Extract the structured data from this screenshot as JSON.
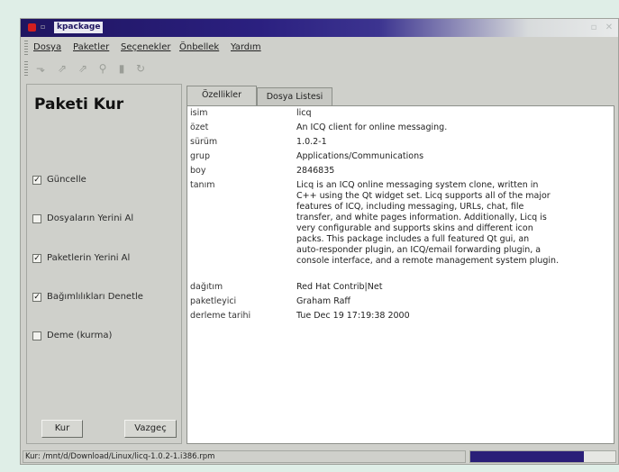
{
  "window": {
    "title": "kpackage",
    "close_icon": "close-icon",
    "menu_icon": "window-menu-icon",
    "minimize_icon": "minimize-icon",
    "maximize_icon": "maximize-icon"
  },
  "menu": {
    "items": [
      "Dosya",
      "Paketler",
      "Seçenekler",
      "Önbellek",
      "Yardım"
    ]
  },
  "toolbar": {
    "icons": [
      "open-icon",
      "install-icon",
      "uninstall-icon",
      "find-icon",
      "list-icon",
      "reload-icon"
    ]
  },
  "install_panel": {
    "title": "Paketi Kur",
    "options": [
      {
        "label": "Güncelle",
        "checked": true
      },
      {
        "label": "Dosyaların Yerini Al",
        "checked": false
      },
      {
        "label": "Paketlerin Yerini Al",
        "checked": true
      },
      {
        "label": "Bağımlılıkları Denetle",
        "checked": true
      },
      {
        "label": "Deme (kurma)",
        "checked": false
      }
    ],
    "install_button": "Kur",
    "cancel_button": "Vazgeç"
  },
  "tabs": [
    {
      "label": "Özellikler",
      "active": true
    },
    {
      "label": "Dosya Listesi",
      "active": false
    }
  ],
  "properties": [
    {
      "key": "isim",
      "value": "licq"
    },
    {
      "key": "özet",
      "value": "An ICQ client for online messaging."
    },
    {
      "key": "sürüm",
      "value": "1.0.2-1"
    },
    {
      "key": "grup",
      "value": "Applications/Communications"
    },
    {
      "key": "boy",
      "value": "2846835"
    },
    {
      "key": "tanım",
      "value": "Licq is an ICQ online messaging system clone, written in\nC++ using the Qt widget set.  Licq supports all of the major\nfeatures of ICQ, including messaging, URLs, chat, file\ntransfer, and white pages information. Additionally, Licq is\nvery configurable and supports skins and different icon\npacks. This package includes a full featured Qt gui, an\nauto-responder plugin, an ICQ/email forwarding plugin, a\nconsole interface, and a remote management system plugin."
    },
    {
      "key": "dağıtım",
      "value": "Red Hat Contrib|Net"
    },
    {
      "key": "paketleyici",
      "value": "Graham Raff"
    },
    {
      "key": "derleme tarihi",
      "value": "Tue Dec 19 17:19:38 2000"
    }
  ],
  "status": {
    "text": "Kur: /mnt/d/Download/Linux/licq-1.0.2-1.i386.rpm",
    "progress": 0.78,
    "progress_color": "#2a1f78"
  },
  "colors": {
    "title_gradient_start": "#1f1560",
    "window_bg": "#cfd0cb",
    "page_bg": "#dfeee7"
  }
}
